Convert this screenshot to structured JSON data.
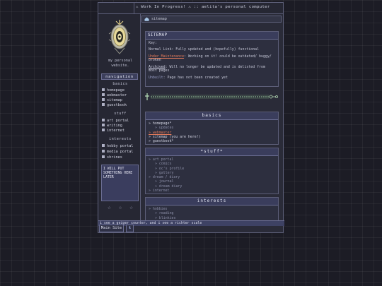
{
  "topbar": {
    "marquee_text": "⚠ Work In Progress! ⚠ :: aelita's personal computer"
  },
  "sidebar": {
    "tagline": "my personal website.",
    "nav_title": "navigation",
    "sections": [
      {
        "title": "basics",
        "items": [
          "homepage",
          "webmaster",
          "sitemap",
          "guestbook"
        ]
      },
      {
        "title": "stuff",
        "items": [
          "art portal",
          "writing",
          "internet"
        ]
      },
      {
        "title": "interests",
        "items": [
          "hobby portal",
          "media portal",
          "shrines"
        ]
      }
    ],
    "sticky_note": "I WILL PUT SOMETHING HERE LATER",
    "stars": "☆ ☆ ☆"
  },
  "breadcrumb": {
    "text": "sitemap"
  },
  "sitemap_box": {
    "title": "SITEMAP",
    "key_label": "Key:",
    "normal_text": "Normal Link: Fully updated and (hopefully) functional",
    "maint_link": "Under Maintenance",
    "maint_text": ": Working on it! could be outdated/ buggy/ broken",
    "archived_link": "Archived",
    "archived_text": ": Will no longer be updated and is delisted from most pages",
    "unbuilt_link": "Unbuilt",
    "unbuilt_text": ": Page has not been created yet"
  },
  "basics_box": {
    "title": "basics",
    "items": [
      {
        "text": "» homepage*",
        "class": ""
      },
      {
        "text": "» updates",
        "class": "sub"
      },
      {
        "text": "» webmaster",
        "class": "hl"
      },
      {
        "text": "» sitemap (you are here!)",
        "class": ""
      },
      {
        "text": "» guestbook*",
        "class": ""
      }
    ]
  },
  "stuff_box": {
    "title": "*stuff*",
    "items": [
      {
        "text": "» art portal",
        "class": "dim"
      },
      {
        "text": "» comics",
        "class": "sub"
      },
      {
        "text": "» oc's profile",
        "class": "sub"
      },
      {
        "text": "» gallery",
        "class": "sub"
      },
      {
        "text": "» dream / diary",
        "class": "dim"
      },
      {
        "text": "» journal",
        "class": "sub"
      },
      {
        "text": "» dream diary",
        "class": "sub"
      },
      {
        "text": "» internet",
        "class": "dim"
      }
    ]
  },
  "interests_box": {
    "title": "interests",
    "items": [
      {
        "text": "» hobbies",
        "class": "dim"
      },
      {
        "text": "» reading",
        "class": "sub"
      },
      {
        "text": "» blinkies",
        "class": "sub"
      }
    ]
  },
  "status_bar": {
    "text": "i see a geiger counter, and i see a richter scale"
  },
  "bottom": {
    "main_site_label": "Main Site",
    "tumblr_label": "t"
  },
  "colors": {
    "accent": "#e27a5a",
    "panel": "#3a3d5c",
    "border": "#5c5e78"
  }
}
